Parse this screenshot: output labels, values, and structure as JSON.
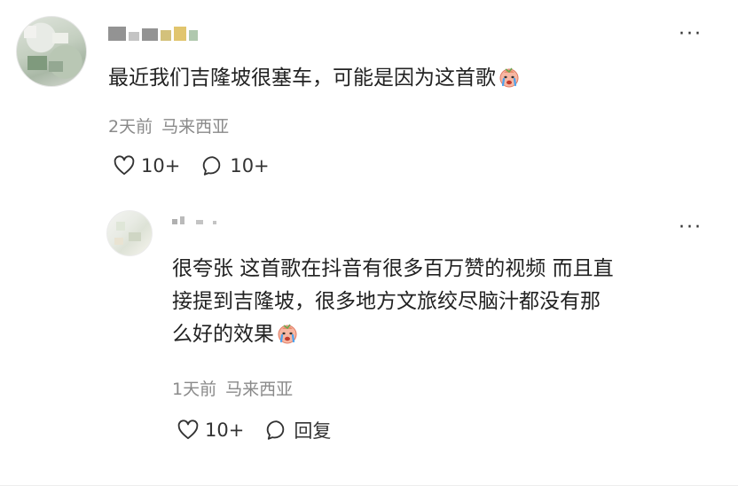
{
  "comment": {
    "text": "最近我们吉隆坡很塞车，可能是因为这首歌",
    "time": "2天前",
    "location": "马来西亚",
    "like_count": "10+",
    "reply_count": "10+"
  },
  "reply": {
    "text_lines": [
      "很夸张 这首歌在抖音有很多百万赞的视频 而且直",
      "接提到吉隆坡，很多地方文旅绞尽脑汁都没有那",
      "么好的效果"
    ],
    "time": "1天前",
    "location": "马来西亚",
    "like_count": "10+",
    "reply_label": "回复"
  },
  "icons": {
    "emoji": "crying-face-emoji",
    "like": "heart-icon",
    "comment": "speech-bubble-icon",
    "more": "more-dots-icon"
  },
  "more_label": "···"
}
